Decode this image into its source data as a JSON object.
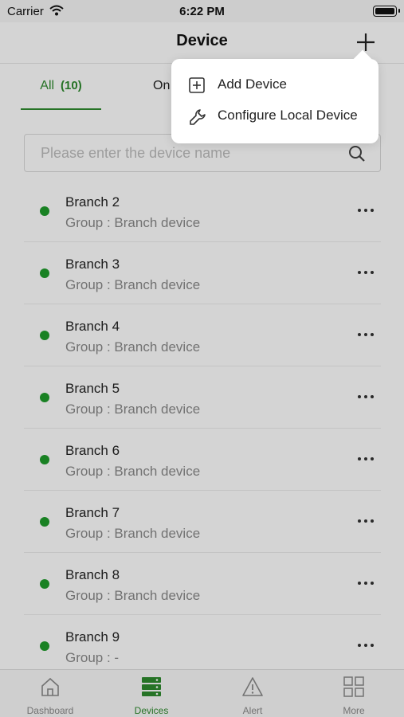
{
  "status_bar": {
    "carrier": "Carrier",
    "time": "6:22 PM"
  },
  "header": {
    "title": "Device"
  },
  "tabs": [
    {
      "label": "All",
      "count": "(10)"
    },
    {
      "label": "On"
    }
  ],
  "search": {
    "placeholder": "Please enter the device name"
  },
  "devices": [
    {
      "name": "Branch 2",
      "group": "Group : Branch device"
    },
    {
      "name": "Branch 3",
      "group": "Group : Branch device"
    },
    {
      "name": "Branch 4",
      "group": "Group : Branch device"
    },
    {
      "name": "Branch 5",
      "group": "Group : Branch device"
    },
    {
      "name": "Branch 6",
      "group": "Group : Branch device"
    },
    {
      "name": "Branch 7",
      "group": "Group : Branch device"
    },
    {
      "name": "Branch 8",
      "group": "Group : Branch device"
    },
    {
      "name": "Branch 9",
      "group": "Group : -"
    }
  ],
  "popup_menu": {
    "items": [
      {
        "label": "Add Device",
        "icon": "add-square-icon"
      },
      {
        "label": "Configure Local Device",
        "icon": "wrench-icon"
      }
    ]
  },
  "tab_bar": {
    "items": [
      {
        "label": "Dashboard",
        "icon": "home-icon"
      },
      {
        "label": "Devices",
        "icon": "server-icon"
      },
      {
        "label": "Alert",
        "icon": "alert-icon"
      },
      {
        "label": "More",
        "icon": "grid-icon"
      }
    ]
  },
  "colors": {
    "accent": "#2e8b2e",
    "online": "#1f9c2b"
  }
}
